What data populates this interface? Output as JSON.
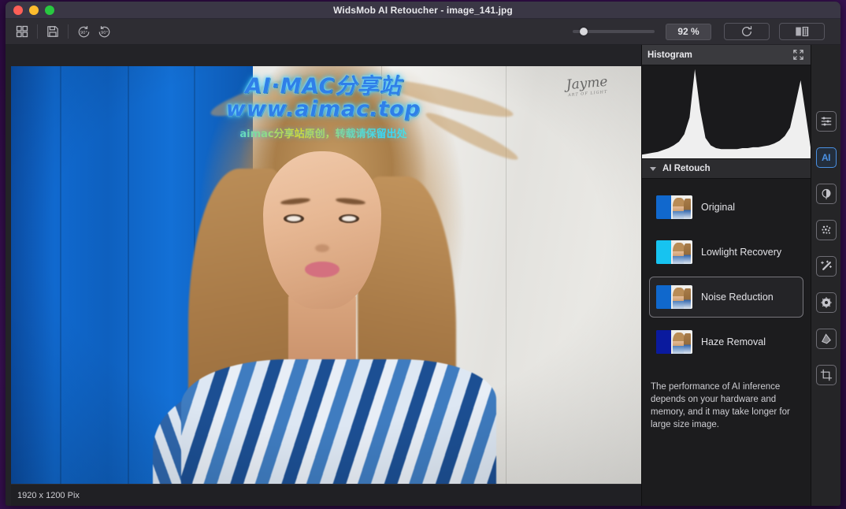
{
  "window": {
    "title": "WidsMob AI Retoucher - image_141.jpg",
    "traffic_lights": [
      "close",
      "minimize",
      "maximize"
    ]
  },
  "toolbar": {
    "items": [
      {
        "name": "grid-icon",
        "tooltip": "Grid view"
      },
      {
        "name": "save-icon",
        "tooltip": "Save"
      },
      {
        "name": "rotate-left-90-icon",
        "tooltip": "Rotate left 90"
      },
      {
        "name": "rotate-right-90-icon",
        "tooltip": "Rotate right 90"
      }
    ],
    "zoom_value": "92 %",
    "zoom_slider_percent": 9,
    "reset_icon": "refresh-icon",
    "compare_icon": "compare-split-icon"
  },
  "canvas": {
    "watermark": {
      "line1": "AI·MAC分享站",
      "line2": "www.aimac.top",
      "line3": "aimac分享站原创，转载请保留出处"
    },
    "photo_signature": "Jayme",
    "photo_signature_sub": "ART OF LIGHT"
  },
  "statusbar": {
    "dimensions": "1920 x 1200 Pix"
  },
  "inspector": {
    "histogram": {
      "title": "Histogram",
      "expand_icon": "expand-icon"
    },
    "ai_retouch": {
      "title": "AI Retouch",
      "collapsed": false,
      "items": [
        {
          "label": "Original",
          "selected": false,
          "thumb_color": "#1168cd"
        },
        {
          "label": "Lowlight Recovery",
          "selected": false,
          "thumb_color": "#17c3f0"
        },
        {
          "label": "Noise Reduction",
          "selected": true,
          "thumb_color": "#1068cc"
        },
        {
          "label": "Haze Removal",
          "selected": false,
          "thumb_color": "#0a1a9e"
        }
      ],
      "note": "The performance of AI inference depends on your hardware and memory, and it may take longer for large size image."
    }
  },
  "rail": {
    "items": [
      {
        "name": "adjustments-sliders-icon",
        "active": false
      },
      {
        "name": "ai-icon",
        "active": true
      },
      {
        "name": "tone-contrast-icon",
        "active": false
      },
      {
        "name": "noise-dots-icon",
        "active": false
      },
      {
        "name": "magic-wand-icon",
        "active": false
      },
      {
        "name": "lens-vignette-icon",
        "active": false
      },
      {
        "name": "tilt-shift-icon",
        "active": false
      },
      {
        "name": "crop-icon",
        "active": false
      }
    ]
  },
  "colors": {
    "accent": "#4a90e2",
    "titlebar": "#3a3745",
    "toolbar": "#2e2d33",
    "panel": "#1c1c1e",
    "desktop": "#2d0b42"
  },
  "chart_data": {
    "type": "area",
    "title": "Histogram",
    "xlabel": "",
    "ylabel": "",
    "xlim": [
      0,
      255
    ],
    "ylim": [
      0,
      100
    ],
    "grid": false,
    "legend": "none",
    "x": [
      0,
      8,
      16,
      24,
      32,
      40,
      48,
      56,
      64,
      72,
      80,
      88,
      96,
      104,
      112,
      120,
      128,
      136,
      144,
      152,
      160,
      168,
      176,
      184,
      192,
      200,
      208,
      216,
      224,
      232,
      240,
      248,
      255
    ],
    "values": [
      4,
      5,
      6,
      7,
      9,
      11,
      14,
      18,
      26,
      44,
      96,
      52,
      22,
      14,
      11,
      10,
      10,
      10,
      10,
      11,
      11,
      12,
      12,
      13,
      14,
      16,
      19,
      24,
      33,
      58,
      84,
      46,
      12
    ]
  }
}
